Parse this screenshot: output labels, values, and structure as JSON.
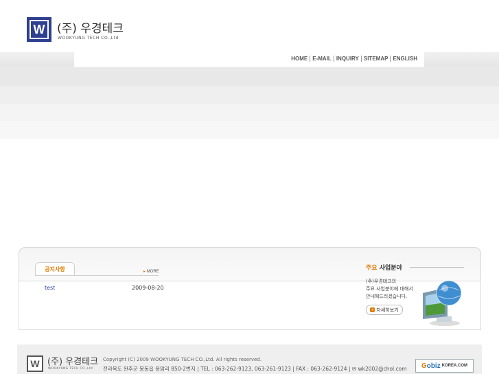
{
  "header": {
    "company_name": "(주) 우경테크",
    "company_sub": "WOOKYUNG TECH CO.,Ltd",
    "logo_letter": "W"
  },
  "nav": {
    "items": [
      "HOME",
      "E-MAIL",
      "INQUIRY",
      "SITEMAP",
      "ENGLISH"
    ]
  },
  "notice": {
    "tab_label": "공지사항",
    "more_label": "MORE",
    "rows": [
      {
        "title": "test",
        "date": "2009-08-20"
      }
    ]
  },
  "business": {
    "title_highlight": "주요",
    "title_rest": " 사업분야",
    "desc_line1": "(주)우경테크의",
    "desc_line2": "주요 사업분야에 대해서",
    "desc_line3": "안내해드리겠습니다.",
    "button_label": "자세히보기"
  },
  "footer": {
    "company_name": "(주) 우경테크",
    "company_sub": "WOOKYUNG TECH CO.,Ltd",
    "logo_letter": "W",
    "copyright": "Copyright (C) 2009 WOOKYUNG TECH CO.,Ltd. All rights reserved.",
    "address": "전라북도 완주군 봉동읍 용암리 850-2번지  |  TEL : 063-262-9123, 063-261-9123  |  FAX : 063-262-9124  |  ✉ wk2002@chol.com",
    "badge_g": "G",
    "badge_text": "obiz",
    "badge_sub": "KOREA.COM"
  },
  "colors": {
    "brand_blue": "#2f3f8f",
    "accent_orange": "#e07b00",
    "link_blue": "#2c3e9f"
  }
}
